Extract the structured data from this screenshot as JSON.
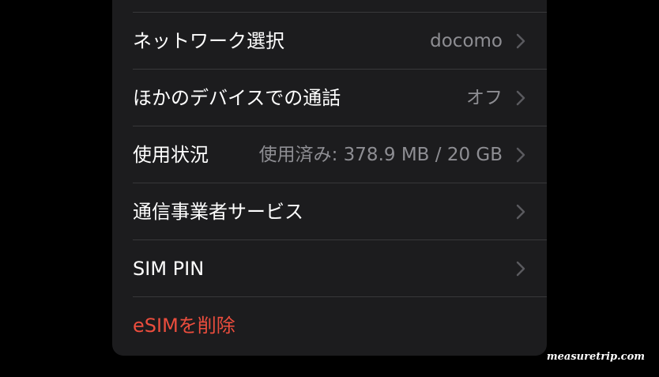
{
  "colors": {
    "background": "#000000",
    "panel": "#1c1c1e",
    "separator": "#38383a",
    "label": "#ffffff",
    "value": "#8e8e93",
    "destructive": "#eb4d3d"
  },
  "settings": {
    "rows": [
      {
        "label": "ネットワーク選択",
        "value": "docomo",
        "chevron": "chevron-right-icon"
      },
      {
        "label": "ほかのデバイスでの通話",
        "value": "オフ",
        "chevron": "chevron-right-icon"
      },
      {
        "label": "使用状況",
        "value": "使用済み: 378.9 MB / 20 GB",
        "chevron": "chevron-right-icon"
      },
      {
        "label": "通信事業者サービス",
        "value": "",
        "chevron": "chevron-right-icon"
      },
      {
        "label": "SIM PIN",
        "value": "",
        "chevron": "chevron-right-icon"
      }
    ],
    "delete_esim_label": "eSIMを削除"
  },
  "watermark": "measuretrip.com"
}
